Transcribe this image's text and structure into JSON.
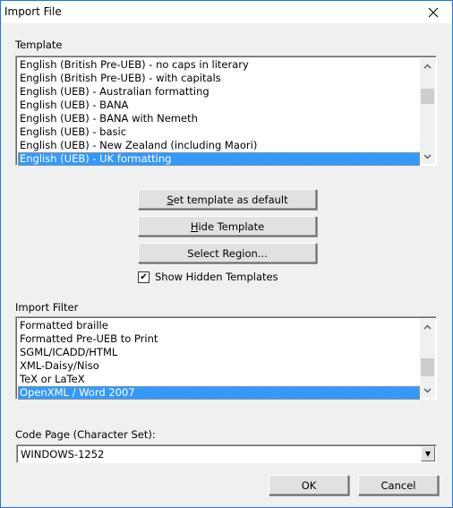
{
  "window": {
    "title": "Import File",
    "close_icon": "close-icon"
  },
  "template": {
    "label": "Template",
    "items": [
      "English (British Pre-UEB) - no caps in literary",
      "English (British Pre-UEB) - with capitals",
      "English (UEB) - Australian formatting",
      "English (UEB) - BANA",
      "English (UEB) - BANA with Nemeth",
      "English (UEB) - basic",
      "English (UEB) - New Zealand (including Maori)",
      "English (UEB) - UK formatting"
    ],
    "selected_index": 7
  },
  "buttons": {
    "set_default": {
      "accel": "S",
      "rest": "et template as default"
    },
    "hide_template": {
      "accel": "H",
      "rest": "ide Template"
    },
    "select_region": "Select Region...",
    "ok": "OK",
    "cancel": "Cancel"
  },
  "show_hidden": {
    "label": "Show Hidden Templates",
    "checked": true,
    "mark": "✔"
  },
  "import_filter": {
    "label": "Import Filter",
    "items": [
      "Formatted braille",
      "Formatted Pre-UEB to Print",
      "SGML/ICADD/HTML",
      "XML-Daisy/Niso",
      "TeX or LaTeX",
      "OpenXML / Word 2007"
    ],
    "selected_index": 5
  },
  "code_page": {
    "label": "Code Page (Character Set):",
    "value": "WINDOWS-1252"
  },
  "scroll_glyphs": {
    "up": "▲",
    "down": "▼",
    "combo": "▼"
  },
  "colors": {
    "selection": "#3399ff",
    "window_border": "#1a7ad4",
    "dialog_bg": "#f0f0f0"
  }
}
